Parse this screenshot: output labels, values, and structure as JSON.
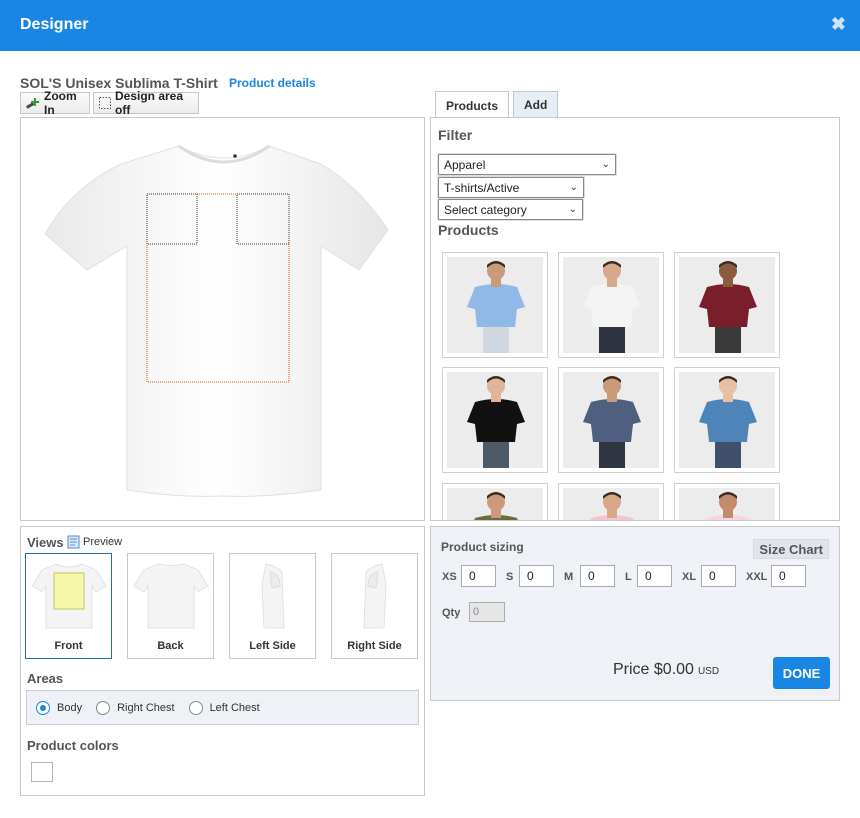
{
  "window": {
    "title": "Designer"
  },
  "product": {
    "name": "SOL'S Unisex Sublima T-Shirt",
    "details_link": "Product details"
  },
  "toolbar": {
    "zoom_in": "Zoom In",
    "design_area": "Design area off"
  },
  "tabs": [
    {
      "label": "Products",
      "active": true
    },
    {
      "label": "Add",
      "active": false
    }
  ],
  "filter": {
    "label": "Filter",
    "selects": [
      {
        "value": "Apparel"
      },
      {
        "value": "T-shirts/Active"
      },
      {
        "value": "Select category"
      }
    ]
  },
  "products": {
    "label": "Products",
    "items": [
      {
        "shirt_color": "#8fb9e6",
        "skin": "#c99b78",
        "pants": "#cfd8e0"
      },
      {
        "shirt_color": "#f4f4f4",
        "skin": "#d8a88a",
        "pants": "#2d3440"
      },
      {
        "shirt_color": "#7a1e2b",
        "skin": "#8a5b3f",
        "pants": "#3a3a3a"
      },
      {
        "shirt_color": "#111111",
        "skin": "#e0b59a",
        "pants": "#4b5a66"
      },
      {
        "shirt_color": "#4f5f7f",
        "skin": "#c99b78",
        "pants": "#2e3440"
      },
      {
        "shirt_color": "#4f84b8",
        "skin": "#e6c0a0",
        "pants": "#40506a"
      },
      {
        "shirt_color": "#6b6b45",
        "skin": "#c99b78",
        "pants": "#444"
      },
      {
        "shirt_color": "#f2c6d0",
        "skin": "#d8a88a",
        "pants": "#444"
      },
      {
        "shirt_color": "#f6d5db",
        "skin": "#c48a6c",
        "pants": "#444"
      }
    ]
  },
  "views": {
    "label": "Views",
    "preview": "Preview",
    "items": [
      {
        "label": "Front",
        "active": true
      },
      {
        "label": "Back",
        "active": false
      },
      {
        "label": "Left Side",
        "active": false
      },
      {
        "label": "Right Side",
        "active": false
      }
    ]
  },
  "areas": {
    "label": "Areas",
    "options": [
      {
        "label": "Body",
        "checked": true
      },
      {
        "label": "Right Chest",
        "checked": false
      },
      {
        "label": "Left Chest",
        "checked": false
      }
    ]
  },
  "product_colors": {
    "label": "Product colors",
    "swatches": [
      "#ffffff"
    ]
  },
  "sizing": {
    "label": "Product sizing",
    "size_chart": "Size Chart",
    "sizes": [
      {
        "label": "XS",
        "value": "0"
      },
      {
        "label": "S",
        "value": "0"
      },
      {
        "label": "M",
        "value": "0"
      },
      {
        "label": "L",
        "value": "0"
      },
      {
        "label": "XL",
        "value": "0"
      },
      {
        "label": "XXL",
        "value": "0"
      }
    ],
    "qty_label": "Qty",
    "qty_value": "0"
  },
  "price": {
    "text": "Price $0.00",
    "currency": "USD"
  },
  "done_label": "DONE"
}
